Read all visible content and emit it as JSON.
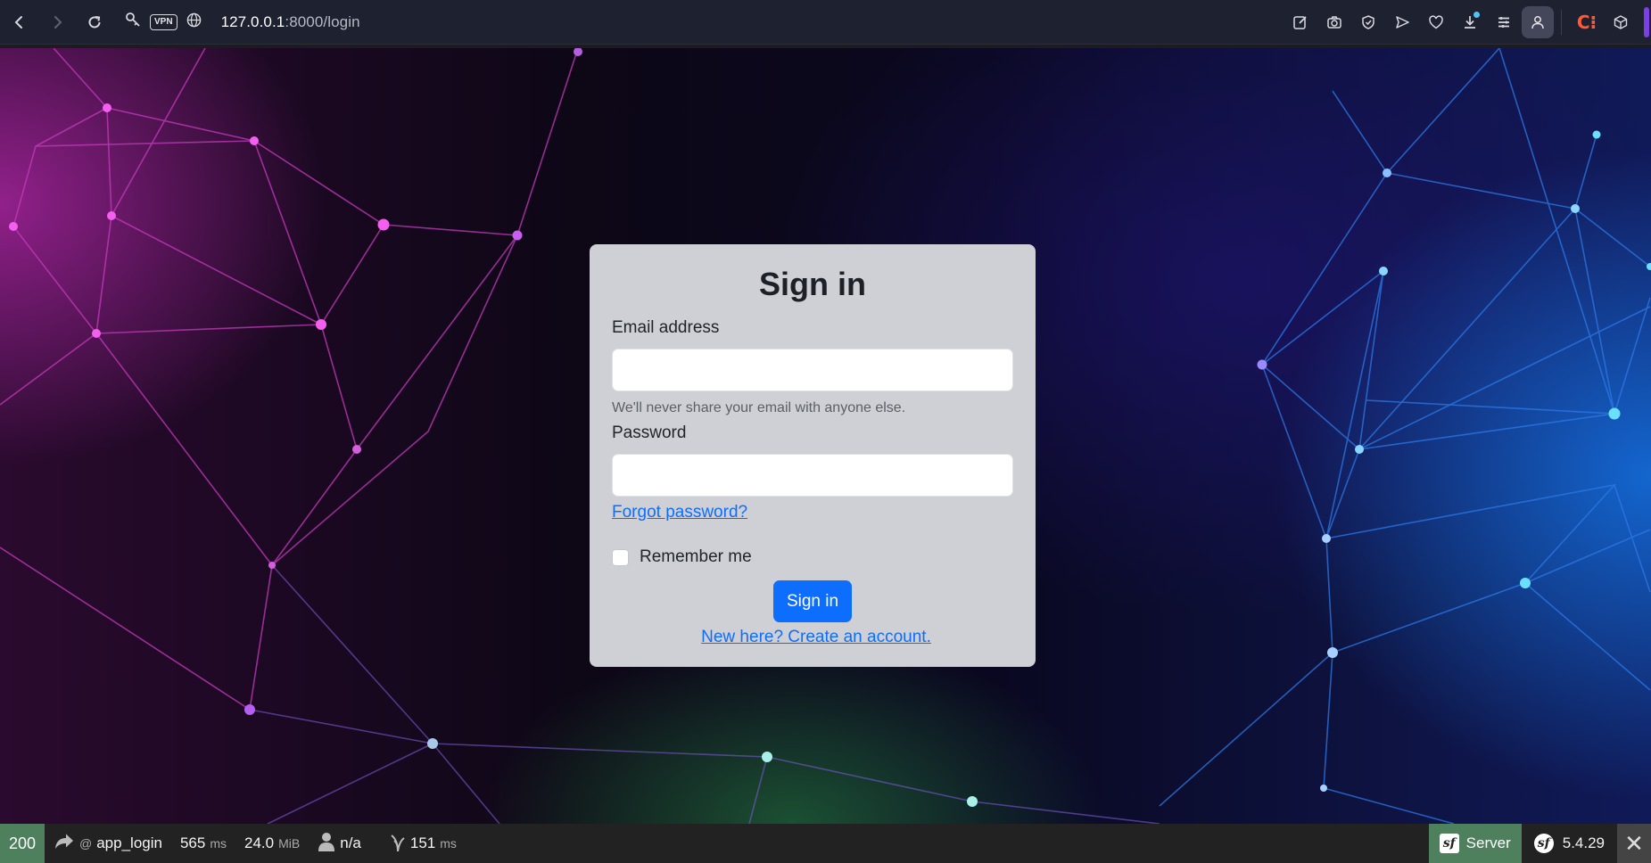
{
  "browser": {
    "url_host": "127.0.0.1",
    "url_rest": ":8000/login",
    "vpn_label": "VPN",
    "icons": [
      "back-icon",
      "forward-icon",
      "reload-icon",
      "key-icon",
      "globe-icon",
      "edit-icon",
      "camera-icon",
      "shield-icon",
      "send-icon",
      "heart-icon",
      "download-icon",
      "menu-icon",
      "profile-icon",
      "cube-icon"
    ]
  },
  "login": {
    "title": "Sign in",
    "email_label": "Email address",
    "email_value": "",
    "email_help": "We'll never share your email with anyone else.",
    "password_label": "Password",
    "password_value": "",
    "forgot_link": "Forgot password?",
    "remember_label": "Remember me",
    "remember_checked": false,
    "submit_label": "Sign in",
    "create_account_link": "New here? Create an account."
  },
  "debug_toolbar": {
    "status_code": "200",
    "route_prefix": "@",
    "route": "app_login",
    "time_value": "565",
    "time_unit": "ms",
    "memory_value": "24.0",
    "memory_unit": "MiB",
    "user": "n/a",
    "twig_value": "151",
    "twig_unit": "ms",
    "server_label": "Server",
    "version": "5.4.29"
  },
  "colors": {
    "primary": "#0d6efd",
    "card_bg": "#cfd0d6",
    "toolbar_status": "#4f805d"
  }
}
